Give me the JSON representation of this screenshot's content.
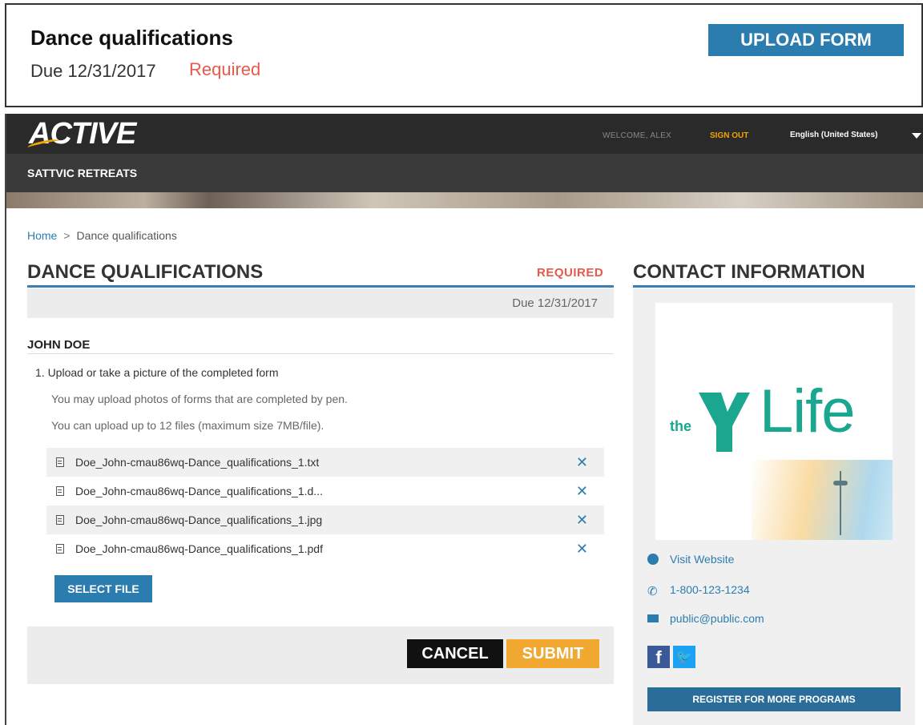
{
  "top_card": {
    "title": "Dance qualifications",
    "due": "Due 12/31/2017",
    "required": "Required",
    "upload_label": "UPLOAD FORM"
  },
  "header": {
    "logo": "ACTIVE",
    "welcome": "WELCOME, ALEX",
    "sign_out": "SIGN OUT",
    "language": "English (United States)",
    "org_name": "SATTVIC RETREATS"
  },
  "breadcrumb": {
    "home": "Home",
    "separator": ">",
    "current": "Dance qualifications"
  },
  "form": {
    "title": "DANCE QUALIFICATIONS",
    "required": "REQUIRED",
    "due": "Due 12/31/2017",
    "person": "JOHN DOE",
    "step": "1. Upload or take a picture of the completed form",
    "note1": "You may upload photos of forms that are completed by pen.",
    "note2": "You can upload up to 12 files (maximum size 7MB/file).",
    "files": [
      {
        "name": "Doe_John-cmau86wq-Dance_qualifications_1.txt"
      },
      {
        "name": "Doe_John-cmau86wq-Dance_qualifications_1.d..."
      },
      {
        "name": "Doe_John-cmau86wq-Dance_qualifications_1.jpg"
      },
      {
        "name": "Doe_John-cmau86wq-Dance_qualifications_1.pdf"
      }
    ],
    "remove_glyph": "✕",
    "select_file": "SELECT FILE",
    "cancel": "CANCEL",
    "submit": "SUBMIT"
  },
  "contact": {
    "title": "CONTACT INFORMATION",
    "logo_the": "the",
    "logo_life": "Life",
    "website": "Visit Website",
    "phone": "1-800-123-1234",
    "email": "public@public.com",
    "facebook": "f",
    "twitter": "🐦",
    "register": "REGISTER FOR MORE PROGRAMS"
  },
  "colors": {
    "accent_blue": "#2b7db0",
    "required_red": "#e55a4a",
    "submit_orange": "#f0a830",
    "ymca_green": "#1aa68f"
  }
}
